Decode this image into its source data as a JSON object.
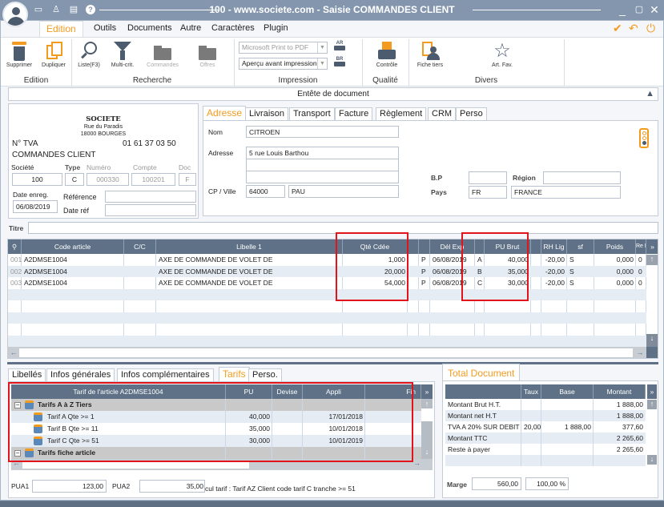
{
  "window": {
    "title": "100 - www.societe.com - Saisie COMMANDES CLIENT",
    "titlebar_icons": [
      "monitor-icon",
      "user-tie-icon",
      "calendar-icon",
      "help-icon"
    ],
    "controls": [
      "minimize",
      "maximize",
      "close"
    ]
  },
  "menu": {
    "active": "Edition",
    "items": [
      "Outils",
      "Documents",
      "Autre",
      "Caractères",
      "Plugin"
    ],
    "actions": [
      "validate-check-icon",
      "undo-arrow-icon",
      "power-icon"
    ]
  },
  "ribbon": {
    "groups": [
      {
        "label": "Edition",
        "buttons": [
          {
            "label": "Supprimer",
            "icon": "trash-icon"
          },
          {
            "label": "Dupliquer",
            "icon": "duplicate-icon"
          }
        ]
      },
      {
        "label": "Recherche",
        "buttons": [
          {
            "label": "Liste(F3)",
            "icon": "magnifier-icon"
          },
          {
            "label": "Multi-crit.",
            "icon": "funnel-icon"
          },
          {
            "label": "Commandes",
            "icon": "folder-icon",
            "disabled": true
          },
          {
            "label": "Offres",
            "icon": "folder-icon",
            "disabled": true
          }
        ]
      },
      {
        "label": "Impression",
        "printer": "Microsoft Print to PDF",
        "mode": "Aperçu avant impression",
        "buttons": [
          {
            "label": "AR",
            "icon": "printer-ar-icon"
          },
          {
            "label": "BR",
            "icon": "printer-br-icon"
          }
        ]
      },
      {
        "label": "Qualité",
        "buttons": [
          {
            "label": "Contrôle",
            "icon": "printer-control-icon"
          }
        ]
      },
      {
        "label": "Divers",
        "buttons": [
          {
            "label": "Fiche tiers",
            "icon": "contact-card-icon"
          },
          {
            "label": "Art. Fav.",
            "icon": "star-icon"
          }
        ]
      }
    ]
  },
  "header": {
    "title": "Entête de document"
  },
  "company": {
    "name": "SOCIETE",
    "street": "Rue du Paradis",
    "city": "18000 BOURGES",
    "tva_label": "N° TVA",
    "phone": "01 61 37 03 50",
    "doc_type": "COMMANDES CLIENT",
    "labels": {
      "societe": "Société",
      "type": "Type",
      "numero": "Numéro",
      "compte": "Compte",
      "doc": "Doc",
      "date_enreg": "Date enreg.",
      "reference": "Référence",
      "date_ref": "Date réf"
    },
    "values": {
      "societe": "100",
      "type": "C",
      "numero": "000330",
      "compte": "100201",
      "doc": "F",
      "date_enreg": "06/08/2019",
      "reference": "",
      "date_ref": ""
    }
  },
  "address_tabs": [
    "Adresse",
    "Livraison",
    "Transport",
    "Facture",
    "Règlement",
    "CRM",
    "Perso"
  ],
  "address": {
    "labels": {
      "nom": "Nom",
      "adresse": "Adresse",
      "cp_ville": "CP / Ville",
      "bp": "B.P",
      "region": "Région",
      "pays": "Pays"
    },
    "nom": "CITROEN",
    "adresse1": "5 rue Louis Barthou",
    "adresse2": "",
    "adresse3": "",
    "cp": "64000",
    "ville": "PAU",
    "bp": "",
    "region": "",
    "pays_code": "FR",
    "pays": "FRANCE"
  },
  "titre": {
    "label": "Titre",
    "value": ""
  },
  "lines": {
    "columns": [
      "Code article",
      "C/C",
      "Libelle 1",
      "Qté Cdée",
      "Dél Exp",
      "PU Brut",
      "RH Lig",
      "sf",
      "Poids",
      "Re B"
    ],
    "rows": [
      {
        "num": "001",
        "code": "A2DMSE1004",
        "libelle": "AXE DE COMMANDE DE VOLET DE",
        "qte": "1,000",
        "p": "P",
        "del": "06/08/2019",
        "tar": "A",
        "pu": "40,000",
        "rh": "-20,00",
        "sf": "S",
        "poids": "0,000",
        "re": "0"
      },
      {
        "num": "002",
        "code": "A2DMSE1004",
        "libelle": "AXE DE COMMANDE DE VOLET DE",
        "qte": "20,000",
        "p": "P",
        "del": "06/08/2019",
        "tar": "B",
        "pu": "35,000",
        "rh": "-20,00",
        "sf": "S",
        "poids": "0,000",
        "re": "0"
      },
      {
        "num": "003",
        "code": "A2DMSE1004",
        "libelle": "AXE DE COMMANDE DE VOLET DE",
        "qte": "54,000",
        "p": "P",
        "del": "06/08/2019",
        "tar": "C",
        "pu": "30,000",
        "rh": "-20,00",
        "sf": "S",
        "poids": "0,000",
        "re": "0"
      }
    ]
  },
  "detail_tabs": [
    "Libellés",
    "Infos générales",
    "Infos complémentaires",
    "Tarifs",
    "Perso."
  ],
  "tarifs": {
    "columns": [
      "Tarif de l'article A2DMSE1004",
      "PU",
      "Devise",
      "Appli",
      "Fin"
    ],
    "groups": [
      {
        "label": "Tarifs A à Z Tiers",
        "rows": [
          {
            "label": "Tarif A Qte >= 1",
            "pu": "40,000",
            "devise": "",
            "appli": "17/01/2018",
            "fin": ""
          },
          {
            "label": "Tarif B Qte >= 11",
            "pu": "35,000",
            "devise": "",
            "appli": "10/01/2018",
            "fin": ""
          },
          {
            "label": "Tarif C Qte >= 51",
            "pu": "30,000",
            "devise": "",
            "appli": "10/01/2019",
            "fin": ""
          }
        ]
      },
      {
        "label": "Tarifs fiche article",
        "rows": []
      }
    ],
    "pua1_label": "PUA1",
    "pua1": "123,00",
    "pua2_label": "PUA2",
    "pua2": "35,00",
    "calc_note": "cul tarif : Tarif AZ Client code tarif C tranche >= 51"
  },
  "totals": {
    "tab": "Total Document",
    "columns": [
      "",
      "Taux",
      "Base",
      "Montant"
    ],
    "rows": [
      {
        "label": "Montant Brut H.T.",
        "taux": "",
        "base": "",
        "montant": "1 888,00"
      },
      {
        "label": "Montant net H.T",
        "taux": "",
        "base": "",
        "montant": "1 888,00"
      },
      {
        "label": "TVA A 20% SUR DEBIT",
        "taux": "20,00",
        "base": "1 888,00",
        "montant": "377,60"
      },
      {
        "label": "Montant TTC",
        "taux": "",
        "base": "",
        "montant": "2 265,60"
      },
      {
        "label": "Reste à payer",
        "taux": "",
        "base": "",
        "montant": "2 265,60"
      }
    ],
    "marge_label": "Marge",
    "marge": "560,00",
    "marge_pct": "100,00 %"
  },
  "colors": {
    "accent": "#f29b1e",
    "grid_header": "#5e7186",
    "highlight": "#e0141a",
    "titlebar": "#8496ad"
  }
}
